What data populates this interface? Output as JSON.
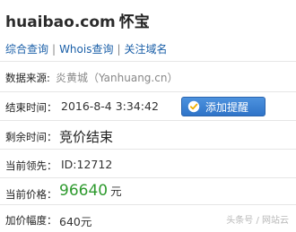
{
  "header": {
    "domain": "huaibao.com",
    "domain_cn": "怀宝"
  },
  "tabs": [
    {
      "label": "综合查询"
    },
    {
      "label": "Whois查询"
    },
    {
      "label": "关注域名"
    }
  ],
  "tab_separator": "|",
  "fields": {
    "source": {
      "label": "数据来源:",
      "value": "炎黄城（Yanhuang.cn）"
    },
    "end_time": {
      "label": "结束时间：",
      "value": "2016-8-4 3:34:42"
    },
    "remaining": {
      "label": "剩余时间：",
      "value": "竞价结束"
    },
    "leader": {
      "label": "当前领先：",
      "value": "ID:12712"
    },
    "price": {
      "label": "当前价格：",
      "value": "96640",
      "unit": "元"
    },
    "increment": {
      "label": "加价幅度：",
      "value": "640元"
    }
  },
  "reminder_button": {
    "label": "添加提醒",
    "icon": "check-circle-icon"
  },
  "watermark": "头条号 / 网站云",
  "colors": {
    "link": "#1a5fa8",
    "price": "#2e9a2e",
    "button": "#3a7fd0"
  }
}
